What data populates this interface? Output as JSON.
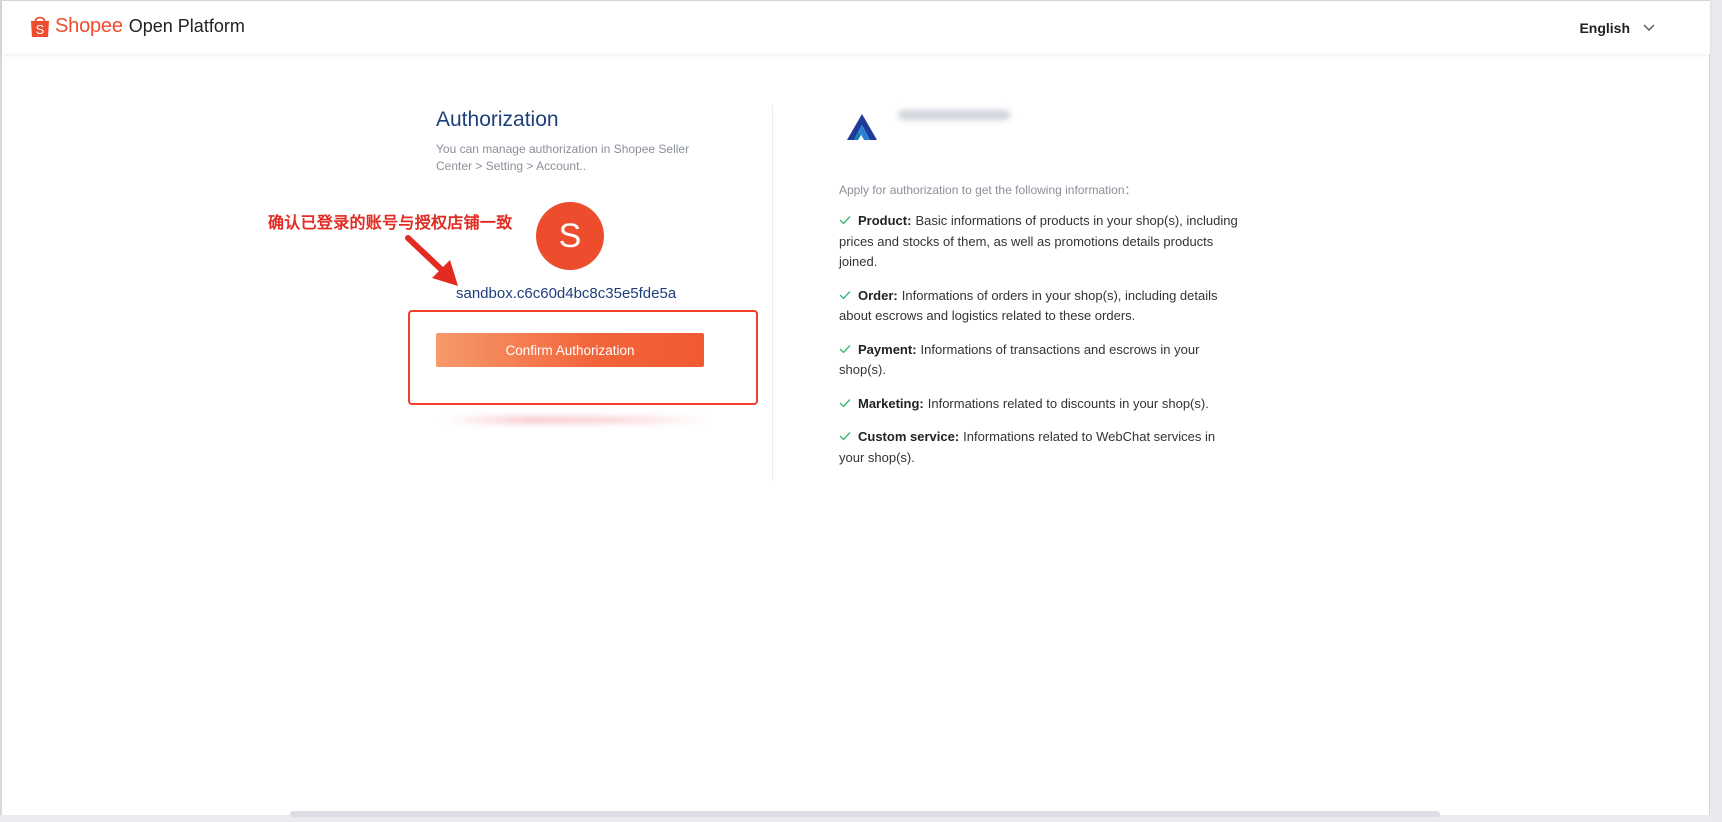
{
  "header": {
    "brand": "Shopee",
    "product": "Open Platform",
    "language": "English"
  },
  "auth": {
    "title": "Authorization",
    "description": "You can manage authorization in Shopee Seller Center > Setting > Account..",
    "avatar_letter": "S",
    "account": "sandbox.c6c60d4bc8c35e5fde5a",
    "confirm_label": "Confirm Authorization",
    "annotation": "确认已登录的账号与授权店铺一致"
  },
  "permissions": {
    "intro": "Apply for authorization to get the following information：",
    "items": [
      {
        "name": "Product:",
        "desc": "Basic informations of products in your shop(s), including prices and stocks of them, as well as promotions details products joined."
      },
      {
        "name": "Order:",
        "desc": "Informations of orders in your shop(s), including details about escrows and logistics related to these orders."
      },
      {
        "name": "Payment:",
        "desc": "Informations of transactions and escrows in your shop(s)."
      },
      {
        "name": "Marketing:",
        "desc": "Informations related to discounts in your shop(s)."
      },
      {
        "name": "Custom service:",
        "desc": "Informations related to WebChat services in your shop(s)."
      }
    ]
  },
  "colors": {
    "brand": "#ee4d2d",
    "title": "#1f3f7a",
    "annotation": "#e32b22",
    "check": "#2eb872"
  }
}
